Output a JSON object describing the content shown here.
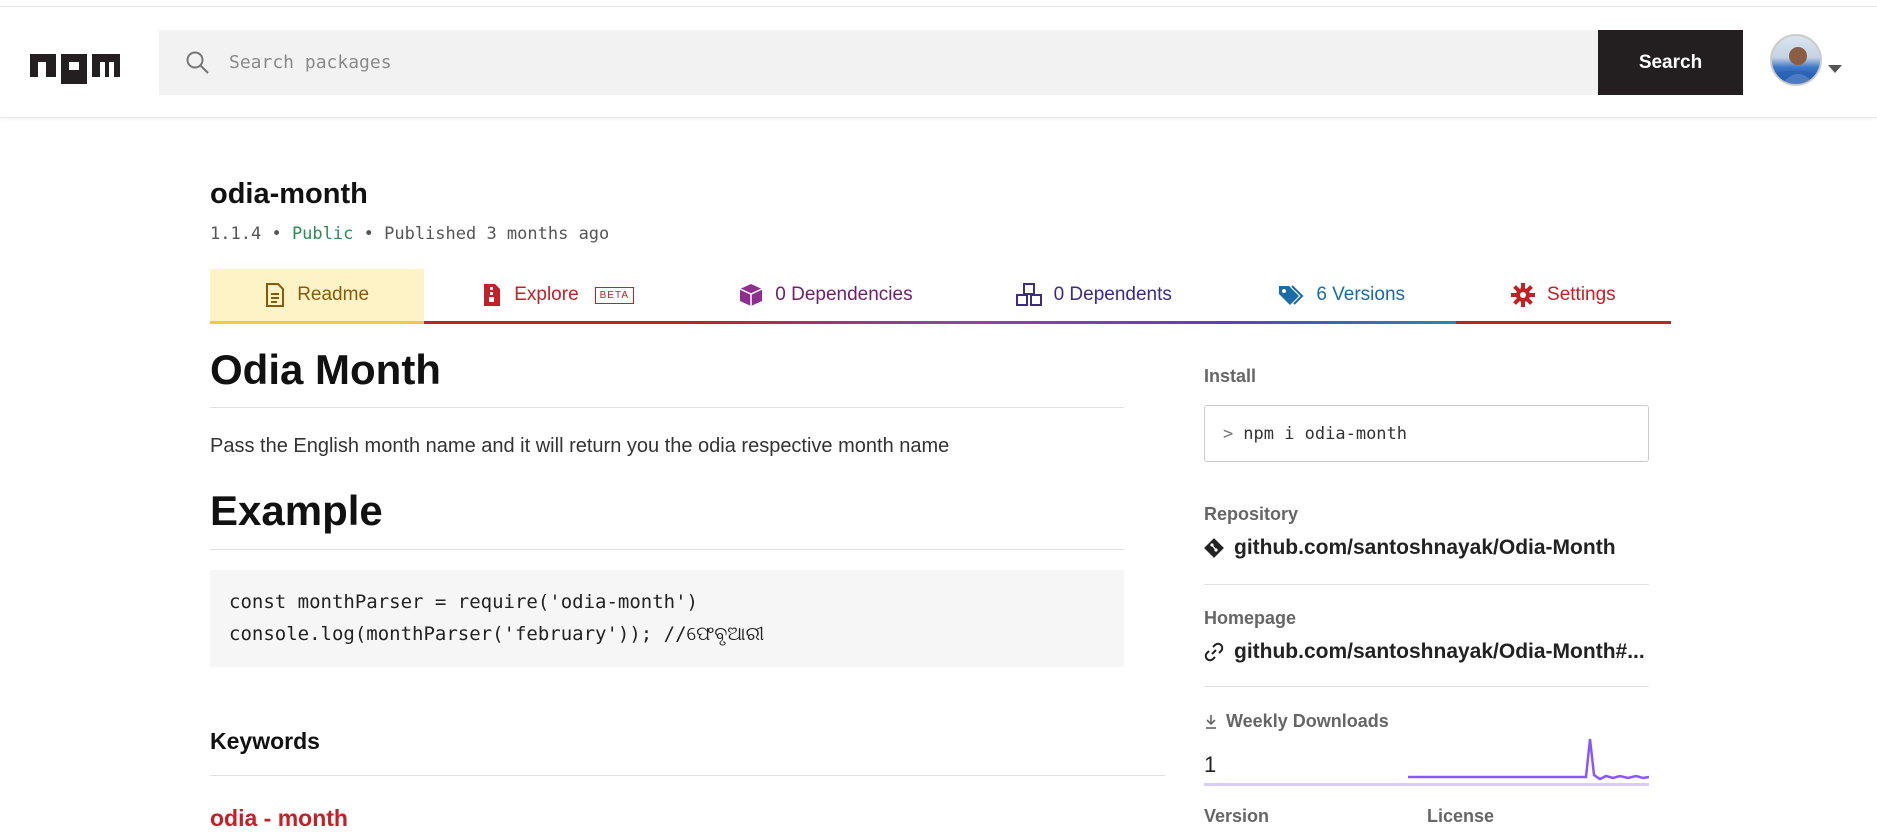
{
  "header": {
    "logo_text": "npm",
    "search_placeholder": "Search packages",
    "search_button_label": "Search"
  },
  "package": {
    "name": "odia-month",
    "version": "1.1.4",
    "separator": "•",
    "visibility": "Public",
    "published": "Published 3 months ago"
  },
  "tabs": [
    {
      "label": "Readme",
      "icon": "document-icon"
    },
    {
      "label": "Explore",
      "badge": "BETA",
      "icon": "file-zip-icon"
    },
    {
      "label": "0 Dependencies",
      "icon": "box-icon"
    },
    {
      "label": "0 Dependents",
      "icon": "boxes-icon"
    },
    {
      "label": "6 Versions",
      "icon": "tags-icon"
    },
    {
      "label": "Settings",
      "icon": "gear-icon"
    }
  ],
  "readme": {
    "title": "Odia Month",
    "description": "Pass the English month name and it will return you the odia respective month name",
    "example_heading": "Example",
    "code_lines": [
      "const monthParser = require('odia-month')",
      "console.log(monthParser('february')); //ଫେବୃଆରୀ"
    ],
    "keywords_heading": "Keywords",
    "keywords": [
      "odia - month"
    ]
  },
  "sidebar": {
    "install_label": "Install",
    "install_prompt": ">",
    "install_command": "npm i odia-month",
    "repository_label": "Repository",
    "repository_link": "github.com/santoshnayak/Odia-Month",
    "homepage_label": "Homepage",
    "homepage_link": "github.com/santoshnayak/Odia-Month#...",
    "downloads_label": "Weekly Downloads",
    "downloads_count": "1",
    "version_label": "Version",
    "license_label": "License"
  },
  "colors": {
    "brand": "#c12127",
    "readme_tab_bg": "#fdf3c7",
    "public_green": "#2d8b5a",
    "sparkline": "#8956ff"
  }
}
